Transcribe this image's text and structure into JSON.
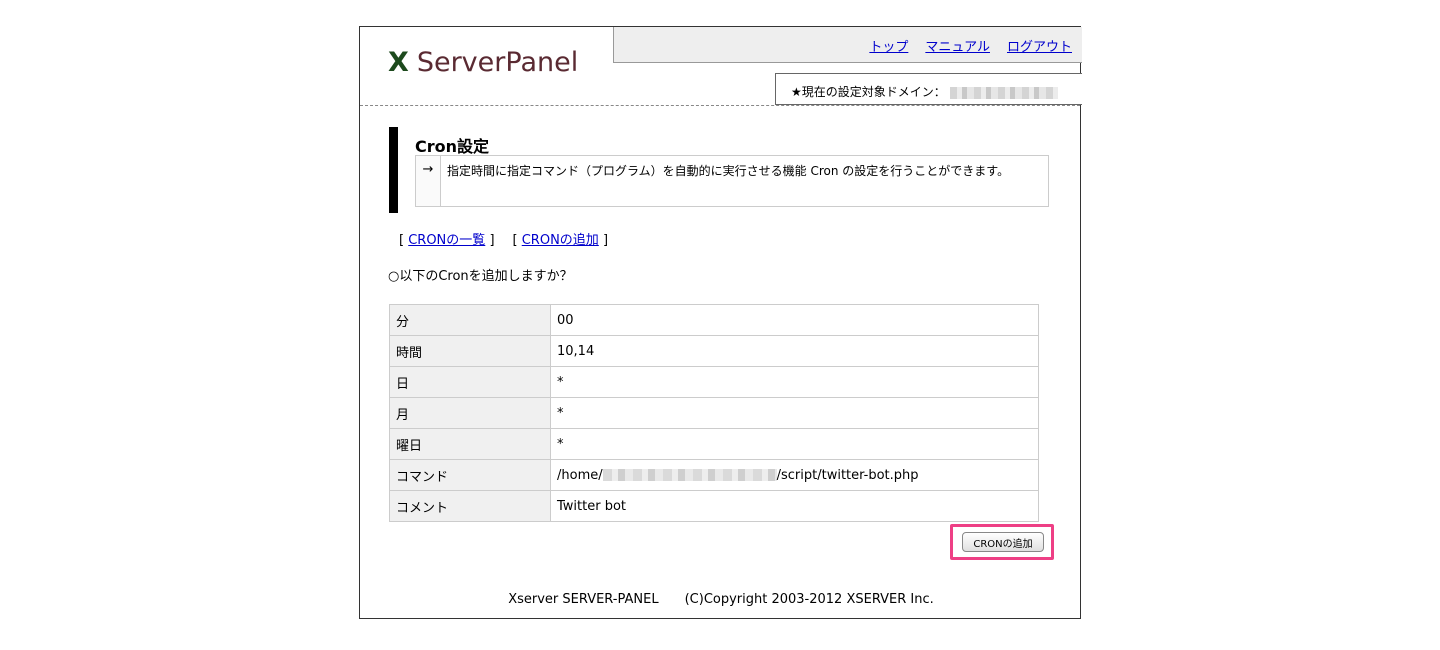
{
  "logo": {
    "mark": "X",
    "text": "ServerPanel"
  },
  "nav": {
    "top": "トップ",
    "manual": "マニュアル",
    "logout": "ログアウト"
  },
  "domain": {
    "label": "★現在の設定対象ドメイン："
  },
  "section": {
    "title": "Cron設定",
    "arrow": "→",
    "description": "指定時間に指定コマンド（プログラム）を自動的に実行させる機能 Cron の設定を行うことができます。"
  },
  "crumbs": {
    "open1": "[",
    "list": "CRONの一覧",
    "close1": "]",
    "open2": "[",
    "add": "CRONの追加",
    "close2": "]"
  },
  "confirm_text": "○以下のCronを追加しますか？",
  "cron": {
    "rows": [
      {
        "key": "分",
        "value": "00"
      },
      {
        "key": "時間",
        "value": "10,14"
      },
      {
        "key": "日",
        "value": "*"
      },
      {
        "key": "月",
        "value": "*"
      },
      {
        "key": "曜日",
        "value": "*"
      },
      {
        "key": "コマンド",
        "value_prefix": "/home/",
        "value_suffix": "/script/twitter-bot.php"
      },
      {
        "key": "コメント",
        "value": "Twitter bot"
      }
    ]
  },
  "add_button": "CRONの追加",
  "footer": {
    "left": "Xserver SERVER-PANEL",
    "right": "(C)Copyright 2003-2012 XSERVER Inc."
  },
  "colors": {
    "logo": "#5a2a32",
    "logo_mark": "#1d4a1d",
    "link": "#0000cc",
    "highlight": "#ee3f85"
  }
}
